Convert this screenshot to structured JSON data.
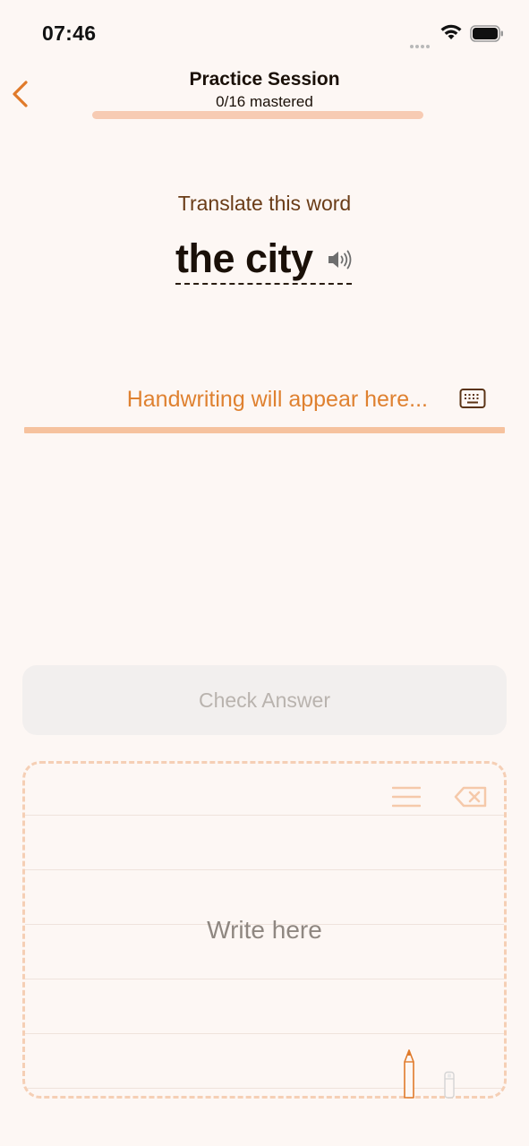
{
  "status_bar": {
    "time": "07:46"
  },
  "header": {
    "title": "Practice Session",
    "subtitle": "0/16 mastered",
    "progress_fraction": 0
  },
  "question": {
    "prompt": "Translate this word",
    "word": "the city"
  },
  "answer": {
    "placeholder": "Handwriting will appear here..."
  },
  "check_button": {
    "label": "Check Answer"
  },
  "writing_pad": {
    "placeholder": "Write here"
  },
  "colors": {
    "accent": "#e07a2a",
    "background": "#fdf7f4",
    "progress_track": "#f7cbb3",
    "pad_border": "#f5cfb5"
  },
  "icons": [
    "back-chevron-icon",
    "speaker-icon",
    "keyboard-icon",
    "menu-icon",
    "backspace-icon",
    "pencil-icon",
    "eraser-icon",
    "wifi-icon",
    "battery-icon",
    "signal-icon"
  ]
}
